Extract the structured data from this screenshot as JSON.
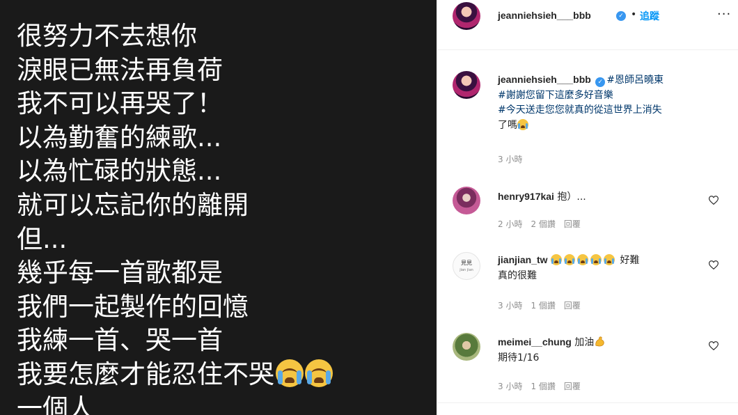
{
  "story": {
    "lines": [
      "很努力不去想你",
      "淚眼已無法再負荷",
      "我不可以再哭了！",
      "以為勤奮的練歌...",
      "以為忙碌的狀態...",
      "就可以忘記你的離開",
      "但...",
      "幾乎每一首歌都是",
      "我們一起製作的回憶",
      "我練一首、哭一首",
      "我要怎麼才能忍住不哭",
      "一個人"
    ],
    "emoji_icon": "loudly-crying-face-icon"
  },
  "header": {
    "username": "jeanniehsieh___bbb",
    "separator": "•",
    "follow_label": "追蹤",
    "more_icon": "···"
  },
  "caption": {
    "username": "jeanniehsieh___bbb",
    "hashtag_1": "#恩師呂曉東",
    "hashtag_2": "#謝謝您留下這麼多好音樂",
    "hashtag_3": "#今天送走您您就真的從這世界上消失",
    "tail": "了嗎",
    "time": "3 小時"
  },
  "comments": [
    {
      "username": "henry917kai",
      "text": "抱）...",
      "time": "2 小時",
      "likes": "2 個讚",
      "reply": "回覆"
    },
    {
      "username": "jianjian_tw",
      "text": "好難",
      "text2": "真的很難",
      "logo_text": "見見",
      "logo_sub": "jian jian",
      "time": "3 小時",
      "likes": "1 個讚",
      "reply": "回覆"
    },
    {
      "username": "meimei__chung",
      "text": "加油",
      "text2": "期待1/16",
      "time": "3 小時",
      "likes": "1 個讚",
      "reply": "回覆"
    }
  ],
  "colors": {
    "link": "#0095f6",
    "hashtag": "#00376b",
    "meta": "#8e8e8e",
    "verified": "#3897f0"
  }
}
